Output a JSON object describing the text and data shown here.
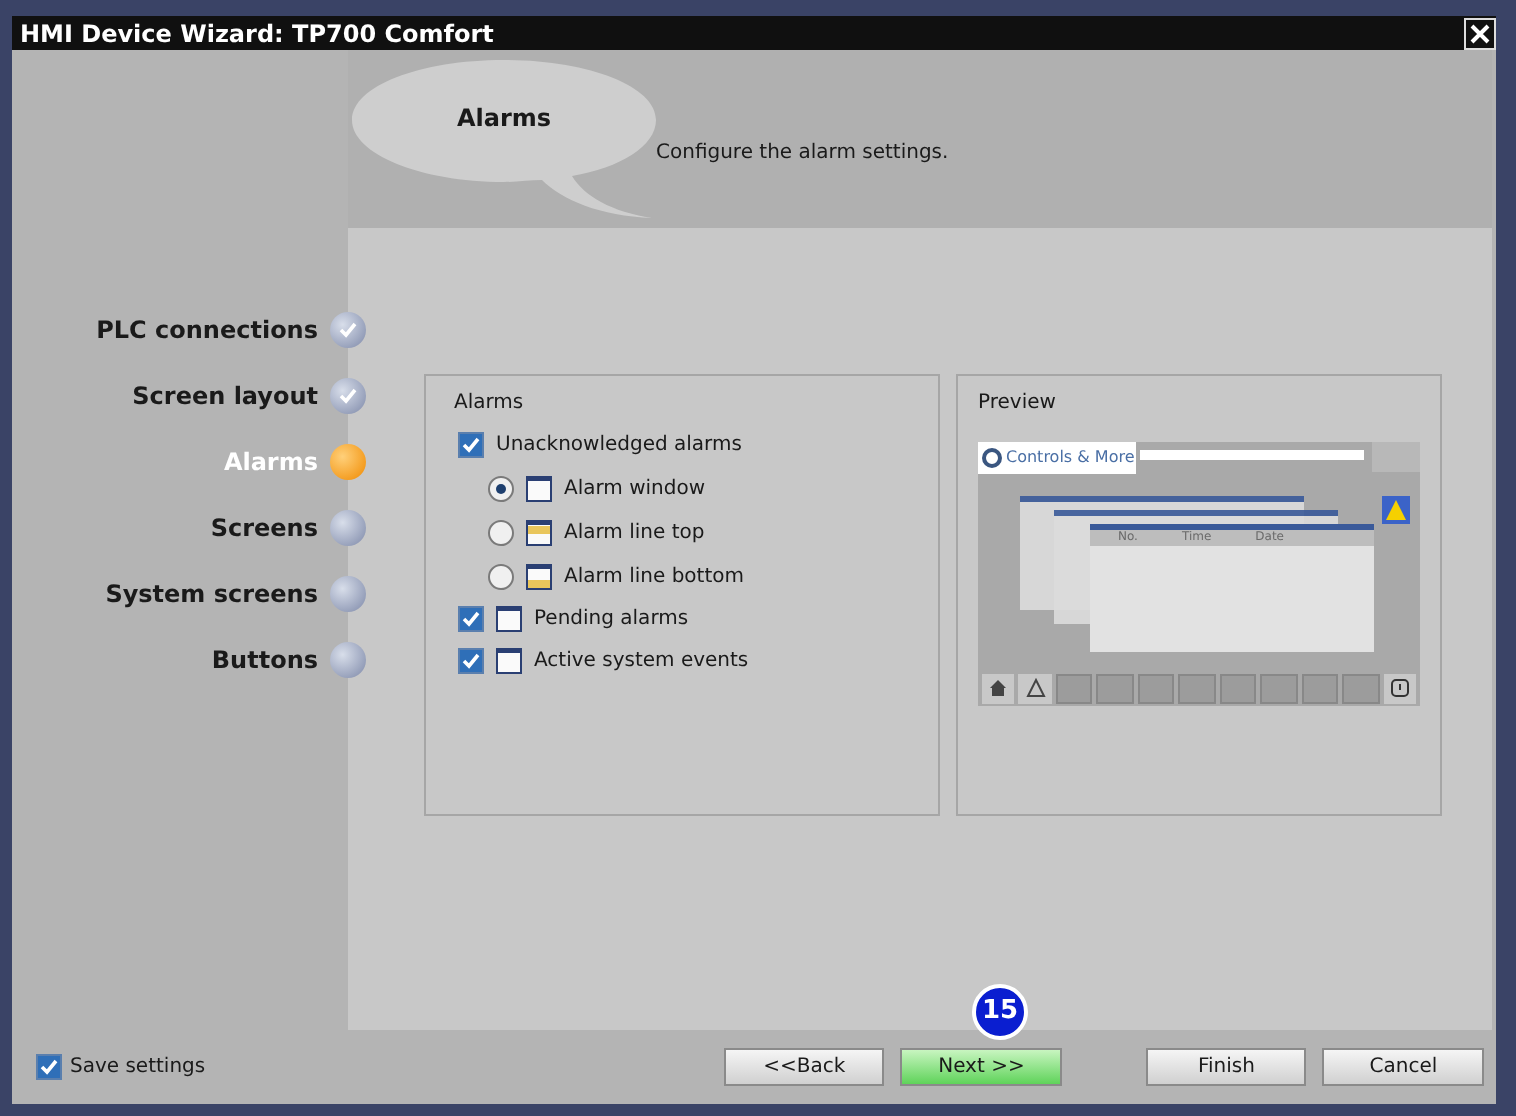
{
  "window": {
    "title": "HMI Device Wizard: TP700 Comfort"
  },
  "header": {
    "title": "Alarms",
    "description": "Configure the alarm settings."
  },
  "steps": [
    {
      "label": "PLC connections",
      "completed": true,
      "selected": false
    },
    {
      "label": "Screen layout",
      "completed": true,
      "selected": false
    },
    {
      "label": "Alarms",
      "completed": false,
      "selected": true
    },
    {
      "label": "Screens",
      "completed": false,
      "selected": false
    },
    {
      "label": "System screens",
      "completed": false,
      "selected": false
    },
    {
      "label": "Buttons",
      "completed": false,
      "selected": false
    }
  ],
  "alarms_group": {
    "title": "Alarms",
    "options": [
      {
        "kind": "checkbox",
        "label": "Unacknowledged alarms",
        "checked": true,
        "children": [
          {
            "kind": "radio",
            "label": "Alarm window",
            "selected": true
          },
          {
            "kind": "radio",
            "label": "Alarm line top",
            "selected": false
          },
          {
            "kind": "radio",
            "label": "Alarm line bottom",
            "selected": false
          }
        ]
      },
      {
        "kind": "checkbox",
        "label": "Pending alarms",
        "checked": true
      },
      {
        "kind": "checkbox",
        "label": "Active system events",
        "checked": true
      }
    ]
  },
  "preview": {
    "title": "Preview",
    "logo_text": "Controls & More",
    "columns": [
      "No.",
      "Time",
      "Date"
    ]
  },
  "annotation_badge": "15",
  "footer": {
    "save_settings": {
      "label": "Save settings",
      "checked": true
    },
    "buttons": [
      {
        "label": "<<Back",
        "primary": false
      },
      {
        "label": "Next >>",
        "primary": true
      },
      {
        "label": "Finish",
        "primary": false
      },
      {
        "label": "Cancel",
        "primary": false
      }
    ]
  }
}
